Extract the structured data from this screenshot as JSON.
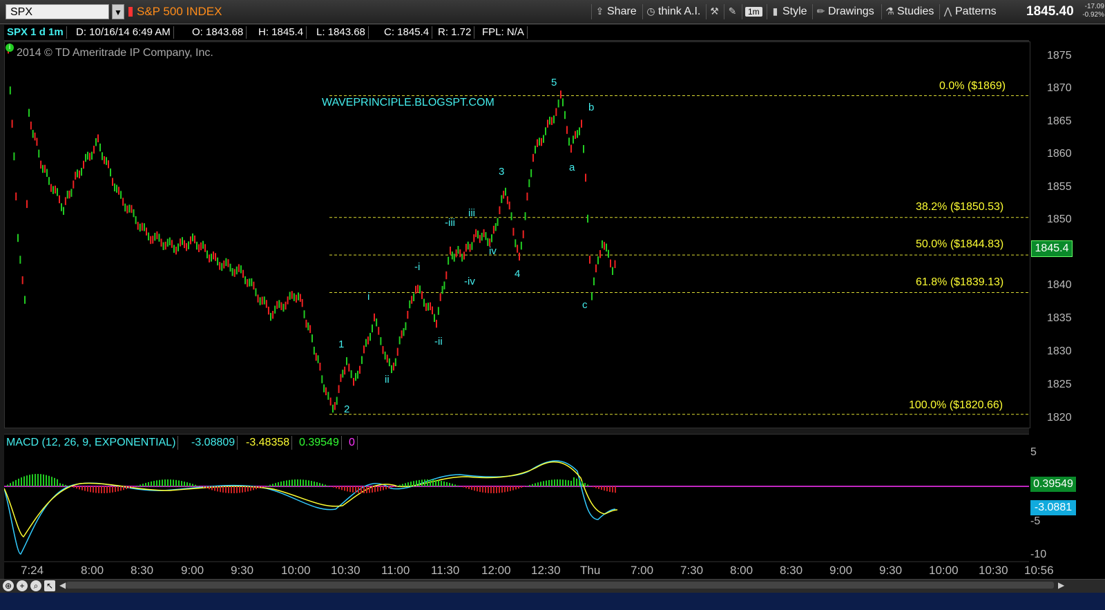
{
  "toolbar": {
    "symbol": "SPX",
    "index_name": "S&P 500 INDEX",
    "buttons": [
      {
        "label": "Share",
        "icon": "share-icon"
      },
      {
        "label": "think A.I.",
        "icon": "clock-icon"
      },
      {
        "label": "",
        "icon": "tools-icon"
      },
      {
        "label": "",
        "icon": "wrench-icon"
      },
      {
        "label": "1m",
        "icon": "timeframe-icon"
      },
      {
        "label": "Style",
        "icon": "style-icon"
      },
      {
        "label": "Drawings",
        "icon": "pencil-icon"
      },
      {
        "label": "Studies",
        "icon": "studies-icon"
      },
      {
        "label": "Patterns",
        "icon": "patterns-icon"
      }
    ],
    "last_price": "1845.40",
    "change": "-17.09",
    "change_pct": "-0.92%"
  },
  "info_row": {
    "series": "SPX 1 d 1m",
    "date": "D: 10/16/14 6:49 AM",
    "open": "O: 1843.68",
    "high": "H: 1845.4",
    "low": "L: 1843.68",
    "close": "C: 1845.4",
    "range": "R: 1.72",
    "fpl": "FPL: N/A"
  },
  "copyright": "2014 © TD Ameritrade IP Company, Inc.",
  "watermark": "WAVEPRINCIPLE.BLOGSPT.COM",
  "price_axis": [
    "1875",
    "1870",
    "1865",
    "1860",
    "1855",
    "1850",
    "1845",
    "1840",
    "1835",
    "1830",
    "1825",
    "1820"
  ],
  "price_badge": "1845.4",
  "fib_levels": [
    {
      "label": "0.0%  ($1869)",
      "price": 1869
    },
    {
      "label": "38.2%  ($1850.53)",
      "price": 1850.53
    },
    {
      "label": "50.0%  ($1844.83)",
      "price": 1844.83
    },
    {
      "label": "61.8%  ($1839.13)",
      "price": 1839.13
    },
    {
      "label": "100.0%  ($1820.66)",
      "price": 1820.66
    }
  ],
  "wave_labels": [
    "1",
    "2",
    "i",
    "ii",
    "-i",
    "-ii",
    "-iii",
    "-iv",
    "iii",
    "iv",
    "3",
    "4",
    "5",
    "a",
    "b",
    "c"
  ],
  "macd": {
    "title": "MACD (12, 26, 9, EXPONENTIAL)",
    "value": "-3.08809",
    "avg": "-3.48358",
    "diff": "0.39549",
    "zero": "0",
    "axis": [
      "5",
      "-5",
      "-10"
    ],
    "badge_diff": "0.39549",
    "badge_value": "-3.0881",
    "colors": {
      "value": "#33ccff",
      "avg": "#ffff33",
      "diff": "#33ff33",
      "zero": "#ff33ff"
    }
  },
  "time_axis": [
    "7:24",
    "8:00",
    "8:30",
    "9:00",
    "9:30",
    "10:00",
    "10:30",
    "11:00",
    "11:30",
    "12:00",
    "12:30",
    "Thu",
    "7:00",
    "7:30",
    "8:00",
    "8:30",
    "9:00",
    "9:30",
    "10:00",
    "10:30",
    "10:56"
  ]
}
